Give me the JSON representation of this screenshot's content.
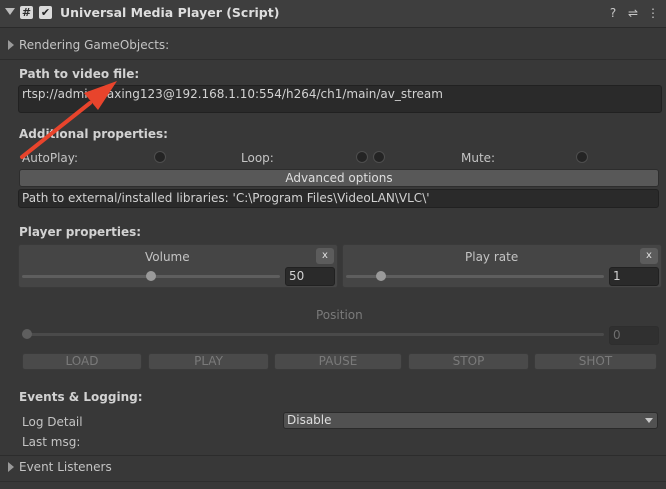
{
  "header": {
    "title": "Universal Media Player (Script)",
    "script_glyph": "#",
    "checkbox_glyph": "✔",
    "help_glyph": "?",
    "presets_glyph": "⇌",
    "menu_glyph": "⋮"
  },
  "rendering": {
    "label": "Rendering GameObjects:"
  },
  "video": {
    "label": "Path to video file:",
    "path": "rtsp://admin:daxing123@192.168.1.10:554/h264/ch1/main/av_stream"
  },
  "additional": {
    "label": "Additional properties:",
    "autoplay": "AutoPlay:",
    "loop": "Loop:",
    "mute": "Mute:",
    "advanced_button": "Advanced options",
    "libs": "Path to external/installed libraries: 'C:\\Program Files\\VideoLAN\\VLC\\'"
  },
  "player": {
    "label": "Player properties:",
    "volume": {
      "label": "Volume",
      "value": "50",
      "level": 0.5,
      "clear": "x"
    },
    "rate": {
      "label": "Play rate",
      "value": "1",
      "level": 0.12,
      "clear": "x"
    }
  },
  "position": {
    "label": "Position",
    "value": "0",
    "level": 0
  },
  "controls": {
    "load": "LOAD",
    "play": "PLAY",
    "pause": "PAUSE",
    "stop": "STOP",
    "shot": "SHOT"
  },
  "events": {
    "label": "Events & Logging:",
    "log_detail": "Log Detail",
    "log_value": "Disable",
    "last_msg": "Last msg:"
  },
  "listeners": {
    "label": "Event Listeners"
  },
  "colors": {
    "background": "#383838",
    "field": "#2a2a2a",
    "arrow": "#e8442c"
  },
  "icons": {
    "arrow": "red-arrow-annotation-icon"
  }
}
